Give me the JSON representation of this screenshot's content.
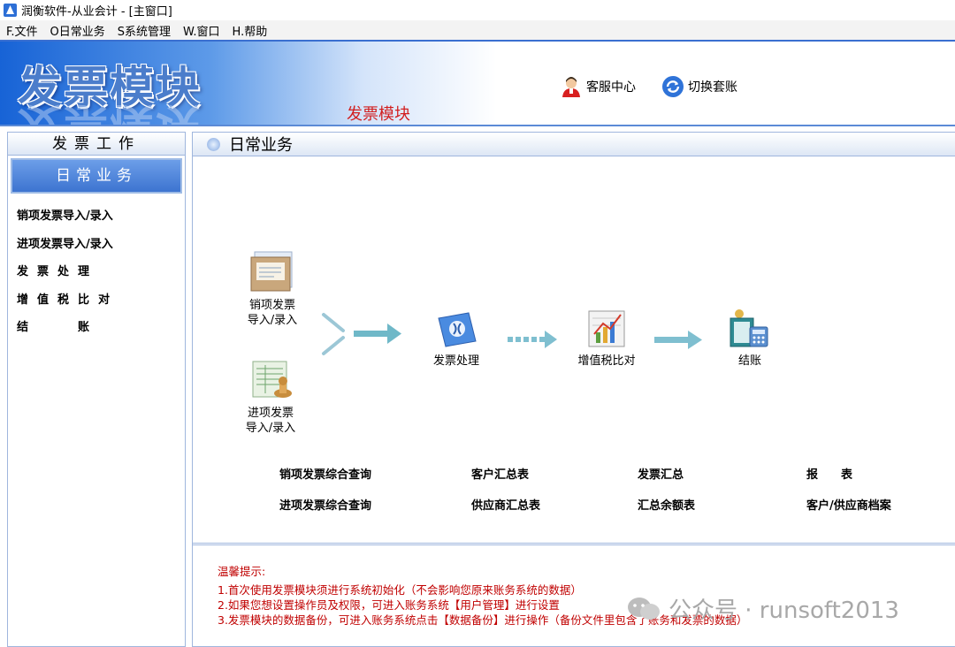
{
  "window": {
    "title": "润衡软件-从业会计 - [主窗口]"
  },
  "menu": [
    "F.文件",
    "O日常业务",
    "S系统管理",
    "W.窗口",
    "H.帮助"
  ],
  "banner": {
    "title": "发票模块",
    "subtitle": "发票模块",
    "service_center": "客服中心",
    "switch_account": "切换套账"
  },
  "left_panel": {
    "title": "发票工作",
    "tab": "日常业务",
    "items": [
      "销项发票导入/录入",
      "进项发票导入/录入",
      "发票处理",
      "增值税比对",
      "结账"
    ]
  },
  "main": {
    "title": "日常业务",
    "flow": {
      "sales_invoice_line1": "销项发票",
      "sales_invoice_line2": "导入/录入",
      "purchase_invoice_line1": "进项发票",
      "purchase_invoice_line2": "导入/录入",
      "invoice_processing": "发票处理",
      "vat_compare": "增值税比对",
      "close_account": "结账"
    },
    "links": {
      "sales_query": "销项发票综合查询",
      "purchase_query": "进项发票综合查询",
      "customer_summary": "客户汇总表",
      "supplier_summary": "供应商汇总表",
      "invoice_summary": "发票汇总",
      "balance_summary": "汇总余额表",
      "report": "报　　表",
      "archive": "客户/供应商档案"
    }
  },
  "tips": {
    "heading": "温馨提示:",
    "lines": [
      "1.首次使用发票模块须进行系统初始化（不会影响您原来账务系统的数据）",
      "2.如果您想设置操作员及权限，可进入账务系统【用户管理】进行设置",
      "3.发票模块的数据备份，可进入账务系统点击【数据备份】进行操作（备份文件里包含了账务和发票的数据）"
    ]
  },
  "watermark": "公众号 · runsoft2013",
  "colors": {
    "accent_blue": "#3d74d0",
    "tip_red": "#c00000",
    "subtitle_red": "#d21f1f",
    "arrow_teal": "#5fb3c4"
  }
}
